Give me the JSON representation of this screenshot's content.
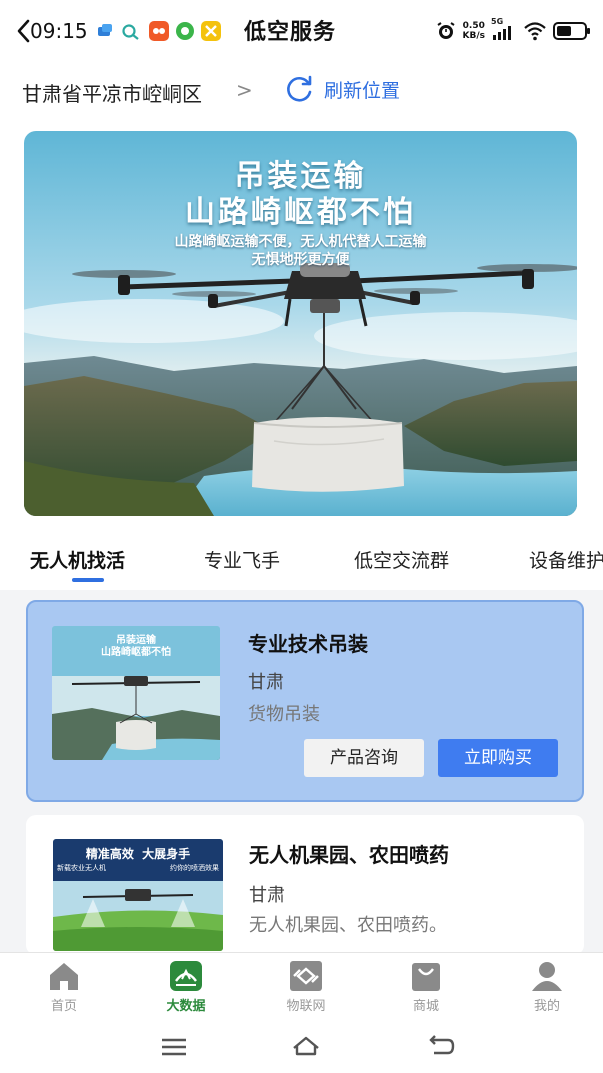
{
  "status_bar": {
    "time": "09:15",
    "net_speed_value": "0.50",
    "net_speed_unit": "KB/s",
    "signal_label": "5G"
  },
  "app": {
    "title": "低空服务"
  },
  "location": {
    "text": "甘肃省平凉市崆峒区",
    "chevron": ">",
    "refresh_label": "刷新位置"
  },
  "banner": {
    "title_line1": "吊装运输",
    "title_line2": "山路崎岖都不怕",
    "subtitle_line1": "山路崎岖运输不便，无人机代替人工运输",
    "subtitle_line2": "无惧地形更方便"
  },
  "tabs": [
    {
      "label": "无人机找活",
      "active": true
    },
    {
      "label": "专业飞手",
      "active": false
    },
    {
      "label": "低空交流群",
      "active": false
    },
    {
      "label": "设备维护",
      "active": false
    }
  ],
  "cards": [
    {
      "title": "专业技术吊装",
      "region": "甘肃",
      "description": "货物吊装",
      "thumb_title1": "吊装运输",
      "thumb_title2": "山路崎岖都不怕",
      "consult_label": "产品咨询",
      "buy_label": "立即购买"
    },
    {
      "title": "无人机果园、农田喷药",
      "region": "甘肃",
      "description": "无人机果园、农田喷药。",
      "thumb_title": "精准高效  大展身手",
      "thumb_sub_left": "新载农业无人机",
      "thumb_sub_right": "约你的喷洒效果"
    }
  ],
  "bottom_nav": [
    {
      "label": "首页",
      "icon": "home-icon",
      "active": false
    },
    {
      "label": "大数据",
      "icon": "big-data-icon",
      "active": true
    },
    {
      "label": "物联网",
      "icon": "iot-icon",
      "active": false
    },
    {
      "label": "商城",
      "icon": "shop-bag-icon",
      "active": false
    },
    {
      "label": "我的",
      "icon": "profile-icon",
      "active": false
    }
  ],
  "colors": {
    "accent": "#2f6fe0",
    "buy_button": "#3f7cf0",
    "highlight_card": "#a9c8f2",
    "nav_active": "#2c8a3c"
  }
}
